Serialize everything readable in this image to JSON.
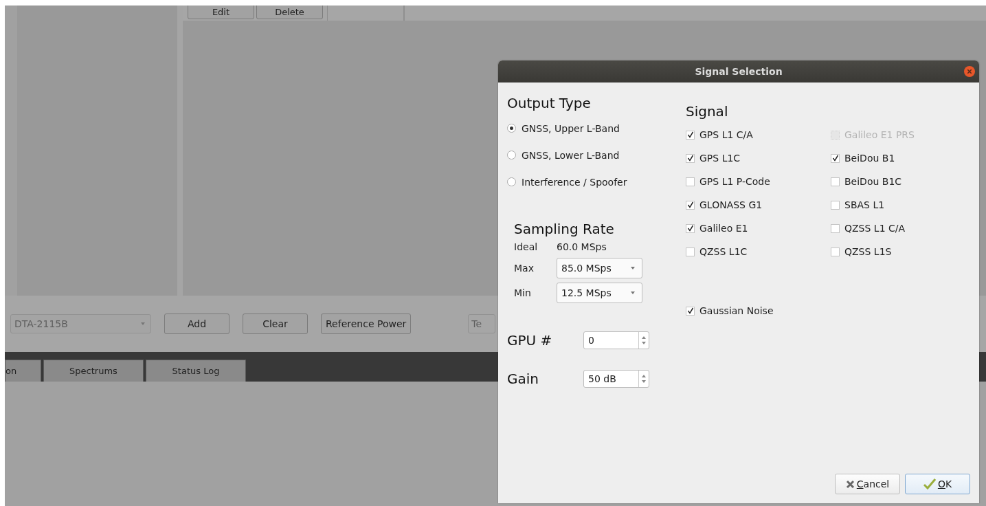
{
  "background_app": {
    "top_buttons": [
      {
        "label": "Edit"
      },
      {
        "label": "Delete"
      }
    ],
    "device_select": {
      "value": "DTA-2115B",
      "disabled": true
    },
    "toolbar_buttons": [
      {
        "label": "Add"
      },
      {
        "label": "Clear"
      },
      {
        "label": "Reference Power"
      }
    ],
    "cut_field": {
      "placeholder": "Te"
    },
    "tabs": [
      {
        "label": "on",
        "selected": false
      },
      {
        "label": "Spectrums",
        "selected": false
      },
      {
        "label": "Status Log",
        "selected": false
      }
    ]
  },
  "dialog": {
    "title": "Signal Selection",
    "output_type": {
      "heading": "Output Type",
      "options": [
        {
          "label": "GNSS, Upper L-Band",
          "selected": true
        },
        {
          "label": "GNSS, Lower L-Band",
          "selected": false
        },
        {
          "label": "Interference / Spoofer",
          "selected": false
        }
      ]
    },
    "sampling_rate": {
      "heading": "Sampling Rate",
      "ideal_label": "Ideal",
      "ideal_value": "60.0 MSps",
      "max_label": "Max",
      "max_value": "85.0 MSps",
      "min_label": "Min",
      "min_value": "12.5 MSps"
    },
    "gpu": {
      "label": "GPU #",
      "value": "0"
    },
    "gain": {
      "label": "Gain",
      "value": "50 dB"
    },
    "signal": {
      "heading": "Signal",
      "columns": [
        {
          "items": [
            {
              "label": "GPS L1 C/A",
              "checked": true,
              "disabled": false
            },
            {
              "label": "GPS L1C",
              "checked": true,
              "disabled": false
            },
            {
              "label": "GPS L1 P-Code",
              "checked": false,
              "disabled": false
            },
            {
              "label": "GLONASS G1",
              "checked": true,
              "disabled": false
            },
            {
              "label": "Galileo E1",
              "checked": true,
              "disabled": false
            },
            {
              "label": "QZSS L1C",
              "checked": false,
              "disabled": false
            }
          ]
        },
        {
          "items": [
            {
              "label": "Galileo E1 PRS",
              "checked": false,
              "disabled": true
            },
            {
              "label": "BeiDou B1",
              "checked": true,
              "disabled": false
            },
            {
              "label": "BeiDou B1C",
              "checked": false,
              "disabled": false
            },
            {
              "label": "SBAS L1",
              "checked": false,
              "disabled": false
            },
            {
              "label": "QZSS L1 C/A",
              "checked": false,
              "disabled": false
            },
            {
              "label": "QZSS L1S",
              "checked": false,
              "disabled": false
            }
          ]
        }
      ]
    },
    "gaussian_noise": {
      "label": "Gaussian Noise",
      "checked": true
    },
    "buttons": [
      {
        "label": "Cancel",
        "kind": "cancel"
      },
      {
        "label": "OK",
        "kind": "ok"
      }
    ]
  }
}
